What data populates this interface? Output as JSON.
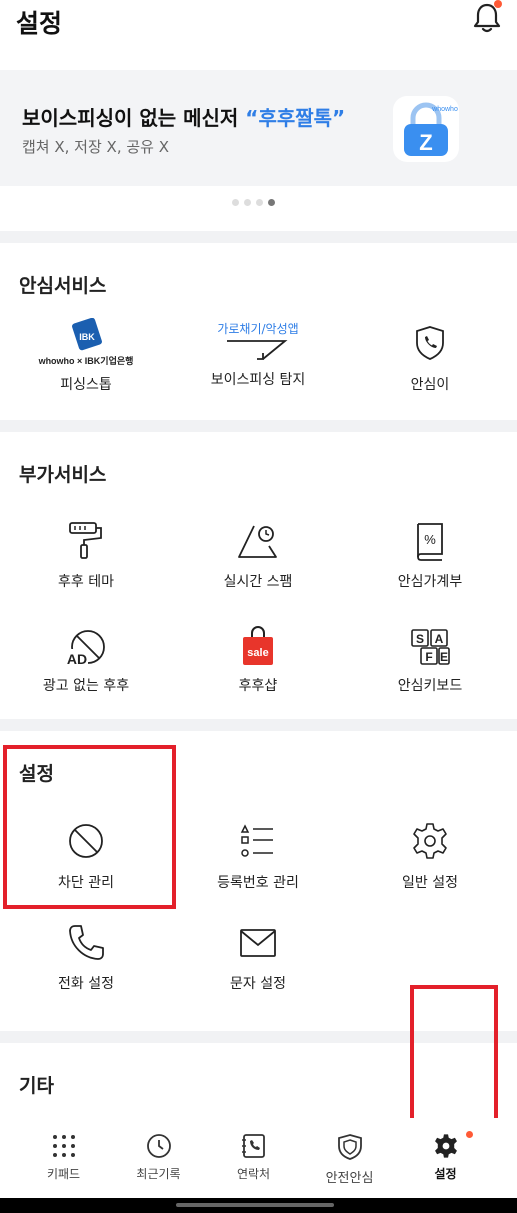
{
  "header": {
    "title": "설정",
    "icon": "bell-icon"
  },
  "banner": {
    "headline": "보이스피싱이 없는 메신저 ",
    "headline_highlight": "“후후짤톡”",
    "subtitle": "캡쳐 X, 저장 X, 공유 X",
    "app_icon_text": "whowho",
    "app_icon_letter": "Z"
  },
  "safety": {
    "title": "안심서비스",
    "items": [
      {
        "label": "피싱스톱",
        "logo_text": "whowho × IBK기업은행",
        "icon": "ibk-logo"
      },
      {
        "label": "보이스피싱 탐지",
        "tag": "가로채기/악성앱",
        "icon": "arrow-icon"
      },
      {
        "label": "안심이",
        "icon": "shield-phone-icon"
      }
    ]
  },
  "extra": {
    "title": "부가서비스",
    "items": [
      {
        "label": "후후 테마",
        "icon": "paint-roller-icon"
      },
      {
        "label": "실시간 스팸",
        "icon": "triangle-clock-icon"
      },
      {
        "label": "안심가계부",
        "icon": "percent-book-icon"
      },
      {
        "label": "광고 없는 후후",
        "icon": "no-ad-icon",
        "icon_text": "AD"
      },
      {
        "label": "후후샵",
        "icon": "sale-bag-icon",
        "icon_text": "sale"
      },
      {
        "label": "안심키보드",
        "icon": "keyboard-icon",
        "keys": [
          "S",
          "A",
          "F",
          "E"
        ]
      }
    ]
  },
  "settings": {
    "title": "설정",
    "items": [
      {
        "label": "차단 관리",
        "icon": "block-icon"
      },
      {
        "label": "등록번호 관리",
        "icon": "list-icon"
      },
      {
        "label": "일반 설정",
        "icon": "gear-icon"
      },
      {
        "label": "전화 설정",
        "icon": "phone-icon"
      },
      {
        "label": "문자 설정",
        "icon": "mail-icon"
      }
    ]
  },
  "other": {
    "title": "기타"
  },
  "nav": {
    "items": [
      {
        "label": "키패드",
        "icon": "keypad-icon"
      },
      {
        "label": "최근기록",
        "icon": "clock-icon"
      },
      {
        "label": "연락처",
        "icon": "contacts-icon"
      },
      {
        "label": "안전안심",
        "icon": "shield-icon"
      },
      {
        "label": "설정",
        "icon": "gear-icon",
        "active": true
      }
    ]
  },
  "colors": {
    "accent": "#2f7ee6",
    "highlight": "#e3202a",
    "badge": "#ff5a36"
  }
}
